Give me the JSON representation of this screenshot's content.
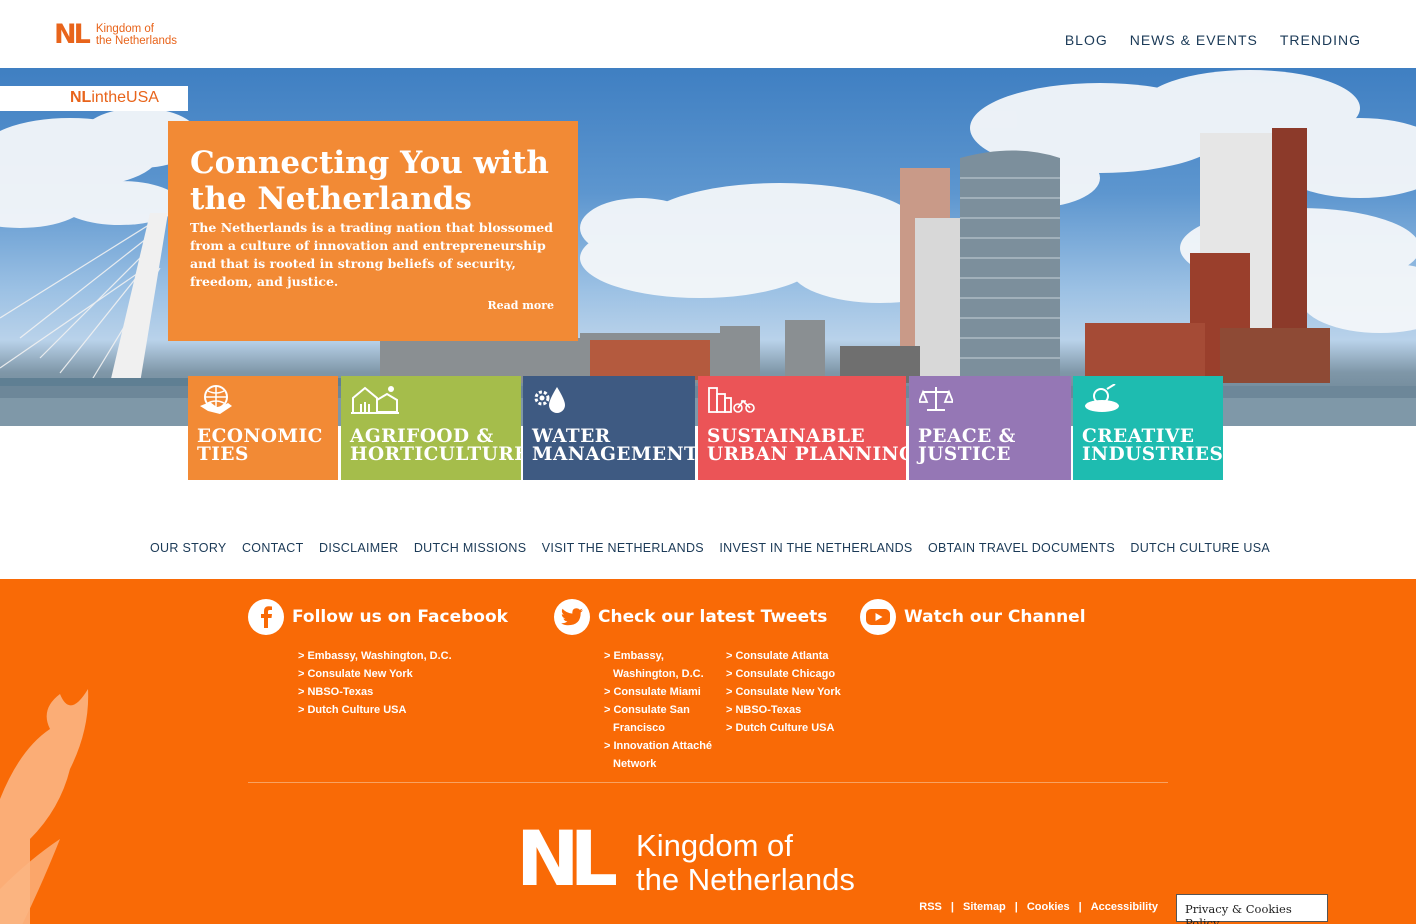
{
  "header": {
    "logo_mark": "NL",
    "logo_text_1": "Kingdom of",
    "logo_text_2": "the Netherlands",
    "nav": [
      "BLOG",
      "NEWS & EVENTS",
      "TRENDING"
    ]
  },
  "hero": {
    "badge_strong": "NL",
    "badge_rest": "intheUSA",
    "title": "Connecting You with the Netherlands",
    "body": "The Netherlands is a trading nation that blossomed from a culture of innovation and entrepreneurship and that is rooted in strong beliefs of security, freedom, and justice.",
    "read_more": "Read more"
  },
  "tiles": [
    {
      "line1": "ECONOMIC",
      "line2": "TIES",
      "color": "#f28a35",
      "icon": "handshake-globe-icon"
    },
    {
      "line1": "AGRIFOOD &",
      "line2": "HORTICULTURE",
      "color": "#a5bd4b",
      "icon": "greenhouse-icon"
    },
    {
      "line1": "WATER",
      "line2": "MANAGEMENT",
      "color": "#3e5a82",
      "icon": "water-drop-gear-icon"
    },
    {
      "line1": "SUSTAINABLE",
      "line2": "URBAN PLANNING",
      "color": "#eb5457",
      "icon": "city-bike-icon"
    },
    {
      "line1": "PEACE &",
      "line2": "JUSTICE",
      "color": "#9577b5",
      "icon": "scales-icon"
    },
    {
      "line1": "CREATIVE",
      "line2": "INDUSTRIES",
      "color": "#1ebcb0",
      "icon": "dj-turntable-icon"
    }
  ],
  "footer_links": [
    "OUR STORY",
    "CONTACT",
    "DISCLAIMER",
    "DUTCH MISSIONS",
    "VISIT THE NETHERLANDS",
    "INVEST IN THE NETHERLANDS",
    "OBTAIN TRAVEL DOCUMENTS",
    "DUTCH CULTURE USA"
  ],
  "social": {
    "facebook": {
      "title": "Follow us on Facebook",
      "links": [
        "Embassy, Washington, D.C.",
        "Consulate New York",
        "NBSO-Texas",
        "Dutch Culture USA"
      ]
    },
    "twitter": {
      "title": "Check our latest Tweets",
      "links_col1": [
        [
          "Embassy,",
          "Washington, D.C."
        ],
        [
          "Consulate Miami"
        ],
        [
          "Consulate San",
          "Francisco"
        ],
        [
          "Innovation Attaché",
          "Network"
        ]
      ],
      "links_col2": [
        "Consulate Atlanta",
        "Consulate Chicago",
        "Consulate New York",
        "NBSO-Texas",
        "Dutch Culture USA"
      ]
    },
    "youtube": {
      "title": "Watch our Channel"
    }
  },
  "footer_logo": {
    "mark": "NL",
    "text_1": "Kingdom of",
    "text_2": "the Netherlands"
  },
  "bottom_links": [
    "RSS",
    "Sitemap",
    "Cookies",
    "Accessibility"
  ],
  "bottom_sep": "|",
  "privacy_label": "Privacy & Cookies Policy",
  "colors": {
    "brand_orange": "#f96a06",
    "hero_box": "#f28a35",
    "nav_text": "#1b3a57"
  }
}
